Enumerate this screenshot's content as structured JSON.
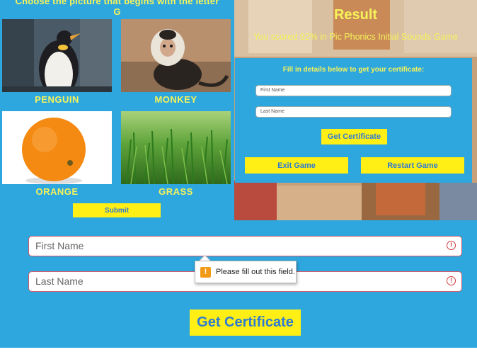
{
  "game": {
    "title_line1": "Choose the picture that begins with the letter",
    "title_line2": "G",
    "tiles": [
      {
        "label": "PENGUIN"
      },
      {
        "label": "MONKEY"
      },
      {
        "label": "ORANGE"
      },
      {
        "label": "GRASS"
      }
    ],
    "submit_label": "Submit"
  },
  "result": {
    "title": "Result",
    "score_text": "You scored 92% in Pic Phonics Initial Sounds Game",
    "panel_heading": "Fill in details below to get your certificate:",
    "first_name_placeholder": "First Name",
    "last_name_placeholder": "Last Name",
    "get_certificate_label": "Get Certificate",
    "exit_label": "Exit Game",
    "restart_label": "Restart Game"
  },
  "form": {
    "first_name_placeholder": "First Name",
    "last_name_placeholder": "Last Name",
    "get_certificate_label": "Get Certificate",
    "validation_message": "Please fill out this field.",
    "error_icon": "!",
    "warning_icon": "!"
  },
  "colors": {
    "background": "#2ea6de",
    "accent_yellow": "#f6f35a",
    "button_yellow": "#ffef14",
    "button_text": "#2f7bd1",
    "error_red": "#d65a6a"
  }
}
